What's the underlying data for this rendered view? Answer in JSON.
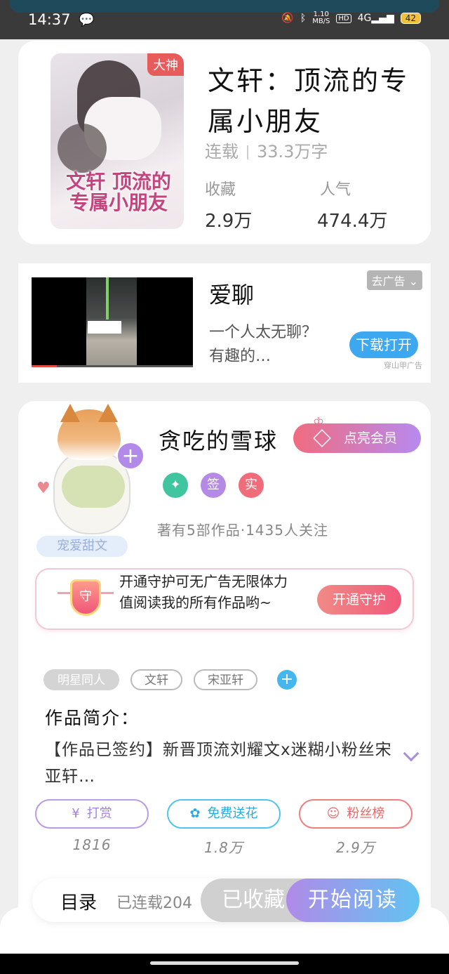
{
  "status_bar": {
    "time": "14:37",
    "speed_value": "1.10",
    "speed_unit": "MB/S",
    "hd": "HD",
    "network": "4G",
    "battery": "42"
  },
  "book": {
    "badge": "大神",
    "title": "文轩：顶流的专属小朋友",
    "status": "连载",
    "word_count": "33.3万字",
    "favorites_label": "收藏",
    "favorites_value": "2.9万",
    "popularity_label": "人气",
    "popularity_value": "474.4万",
    "cover_title": "文轩 顶流的专属小朋友"
  },
  "ad": {
    "remove_label": "去广告",
    "title": "爱聊",
    "description": "一个人太无聊？有趣的…",
    "button": "下载打开",
    "source": "穿山甲广告"
  },
  "author": {
    "avatar_tag": "宠爱甜文",
    "name": "贪吃的雪球",
    "vip_button": "点亮会员",
    "badge_sign": "签",
    "badge_real": "实",
    "stats": "著有5部作品·1435人关注",
    "guard_text": "开通守护可无广告无限体力值阅读我的所有作品哟~",
    "guard_icon_text": "守",
    "guard_button": "开通守护"
  },
  "tags": [
    "明星同人",
    "文轩",
    "宋亚轩"
  ],
  "intro": {
    "label": "作品简介：",
    "text": "【作品已签约】新晋顶流刘耀文x迷糊小粉丝宋亚轩…"
  },
  "actions": [
    {
      "label": "打赏",
      "count": "1816",
      "icon": "yen-coin-icon"
    },
    {
      "label": "免费送花",
      "count": "1.8万",
      "icon": "flower-icon"
    },
    {
      "label": "粉丝榜",
      "count": "2.9万",
      "icon": "fan-person-icon"
    }
  ],
  "bottom_bar": {
    "catalog": "目录",
    "status": "已连载204",
    "saved": "已收藏",
    "read": "开始阅读"
  },
  "colors": {
    "accent_purple": "#b08ae8",
    "accent_blue": "#3da7f0",
    "accent_red": "#f06c7a",
    "badge_red": "#e85b5b"
  }
}
